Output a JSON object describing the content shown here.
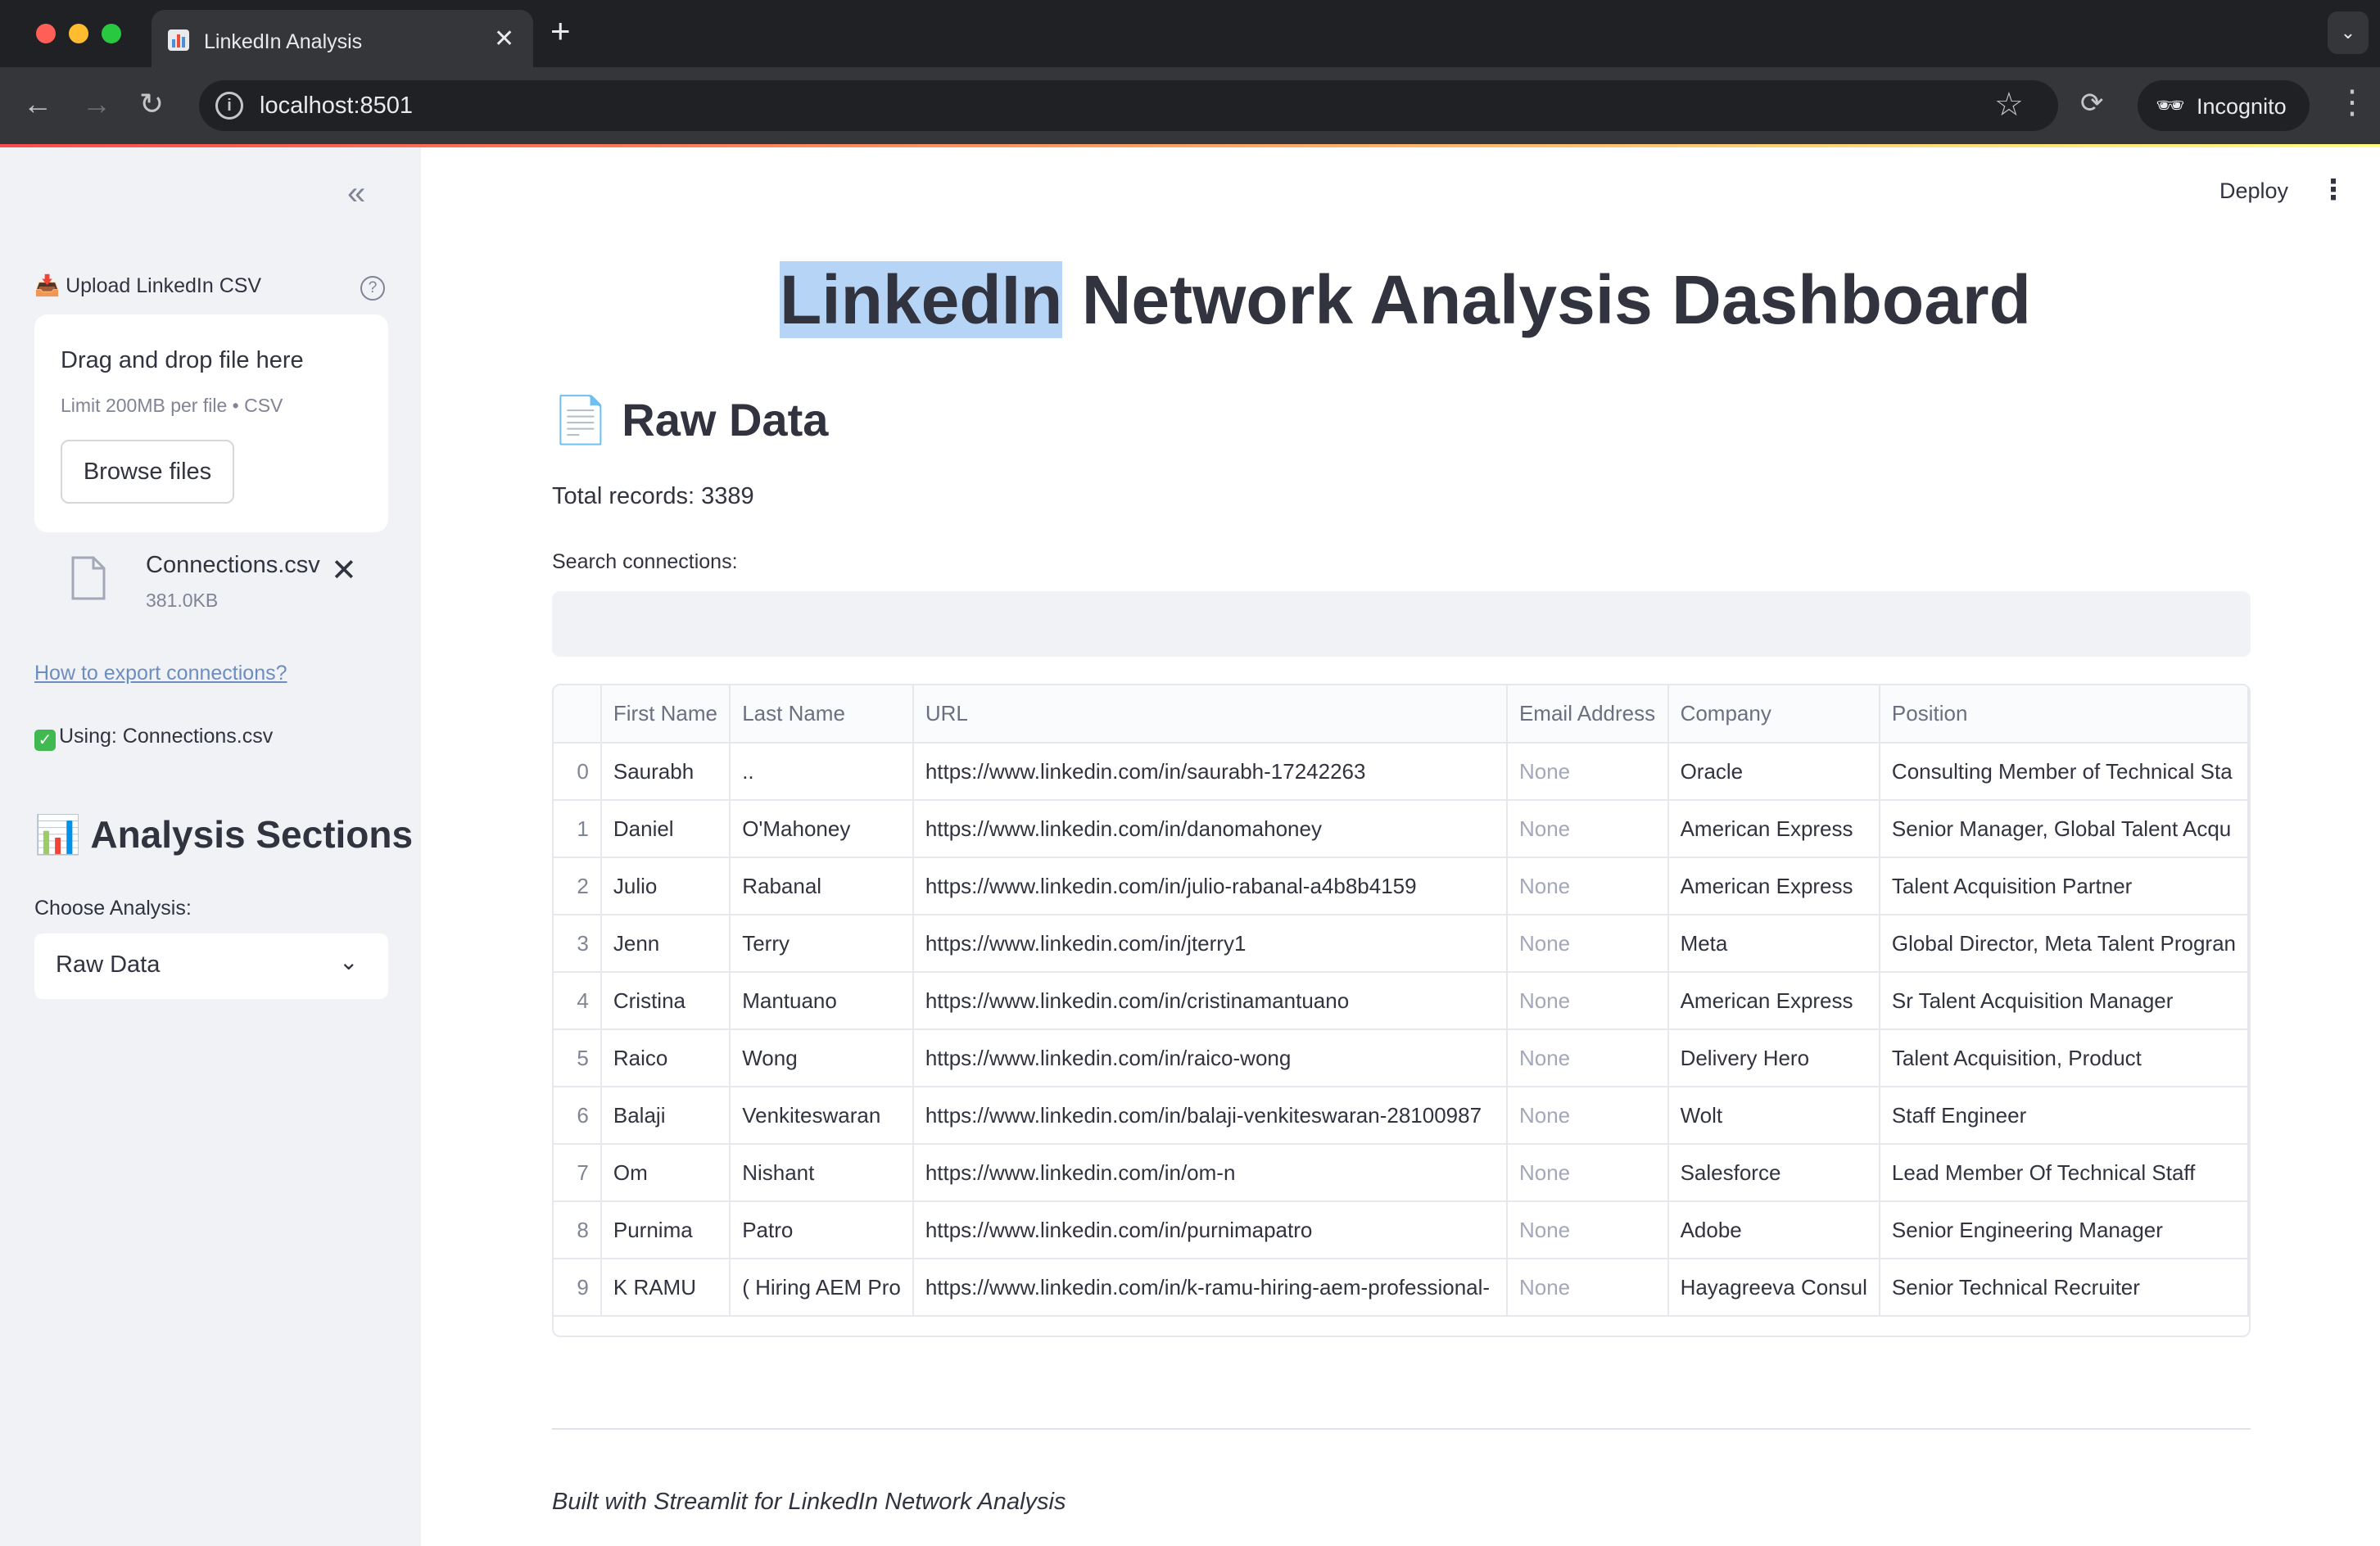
{
  "browser": {
    "tab_title": "LinkedIn Analysis",
    "url": "localhost:8501",
    "incognito_label": "Incognito"
  },
  "sidebar": {
    "upload_label": "📥 Upload LinkedIn CSV",
    "drop_title": "Drag and drop file here",
    "drop_limit": "Limit 200MB per file • CSV",
    "browse_label": "Browse files",
    "file_name": "Connections.csv",
    "file_size": "381.0KB",
    "howto_link": "How to export connections?",
    "using_text": "Using: Connections.csv",
    "section_heading": "📊 Analysis Sections",
    "choose_label": "Choose Analysis:",
    "choose_value": "Raw Data"
  },
  "header": {
    "deploy_label": "Deploy"
  },
  "main": {
    "title_highlight": "LinkedIn",
    "title_rest": " Network Analysis Dashboard",
    "section_heading": "📄 Raw Data",
    "total_records": "Total records: 3389",
    "search_label": "Search connections:",
    "columns": [
      "",
      "First Name",
      "Last Name",
      "URL",
      "Email Address",
      "Company",
      "Position"
    ],
    "rows": [
      [
        "0",
        "Saurabh",
        "..",
        "https://www.linkedin.com/in/saurabh-17242263",
        "None",
        "Oracle",
        "Consulting Member of Technical Sta"
      ],
      [
        "1",
        "Daniel",
        "O'Mahoney",
        "https://www.linkedin.com/in/danomahoney",
        "None",
        "American Express",
        "Senior Manager, Global Talent Acqu"
      ],
      [
        "2",
        "Julio",
        "Rabanal",
        "https://www.linkedin.com/in/julio-rabanal-a4b8b4159",
        "None",
        "American Express",
        "Talent Acquisition Partner"
      ],
      [
        "3",
        "Jenn",
        "Terry",
        "https://www.linkedin.com/in/jterry1",
        "None",
        "Meta",
        "Global Director, Meta Talent Progran"
      ],
      [
        "4",
        "Cristina",
        "Mantuano",
        "https://www.linkedin.com/in/cristinamantuano",
        "None",
        "American Express",
        "Sr Talent Acquisition Manager"
      ],
      [
        "5",
        "Raico",
        "Wong",
        "https://www.linkedin.com/in/raico-wong",
        "None",
        "Delivery Hero",
        "Talent Acquisition, Product"
      ],
      [
        "6",
        "Balaji",
        "Venkiteswaran",
        "https://www.linkedin.com/in/balaji-venkiteswaran-28100987",
        "None",
        "Wolt",
        "Staff Engineer"
      ],
      [
        "7",
        "Om",
        "Nishant",
        "https://www.linkedin.com/in/om-n",
        "None",
        "Salesforce",
        "Lead Member Of Technical Staff"
      ],
      [
        "8",
        "Purnima",
        "Patro",
        "https://www.linkedin.com/in/purnimapatro",
        "None",
        "Adobe",
        "Senior Engineering Manager"
      ],
      [
        "9",
        "K RAMU",
        "( Hiring AEM Pro",
        "https://www.linkedin.com/in/k-ramu-hiring-aem-professional-",
        "None",
        "Hayagreeva Consul",
        "Senior Technical Recruiter"
      ]
    ],
    "footer": "Built with Streamlit for LinkedIn Network Analysis"
  }
}
